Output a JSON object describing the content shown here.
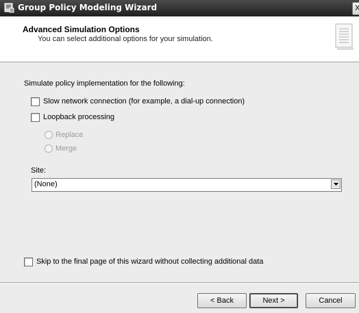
{
  "window": {
    "title": "Group Policy Modeling Wizard",
    "close_label": "X"
  },
  "header": {
    "title": "Advanced Simulation Options",
    "subtitle": "You can select additional options for your simulation."
  },
  "options": {
    "intro": "Simulate policy implementation for the following:",
    "slow_network_label": "Slow network connection (for example, a dial-up connection)",
    "slow_network_checked": false,
    "loopback_label": "Loopback processing",
    "loopback_checked": false,
    "loopback_modes": [
      "Replace",
      "Merge"
    ],
    "site_label": "Site:",
    "site_value": "(None)",
    "skip_label": "Skip to the final page of this wizard without collecting additional data",
    "skip_checked": false
  },
  "buttons": {
    "back": "< Back",
    "next": "Next >",
    "cancel": "Cancel"
  },
  "icons": [
    "wizard-app-icon",
    "document-icon",
    "dropdown-arrow-icon"
  ],
  "colors": {
    "titlebar": "#2e2e2e",
    "header_bg": "#ffffff",
    "dialog_bg": "#ececec",
    "disabled_text": "#9a9a9a"
  }
}
